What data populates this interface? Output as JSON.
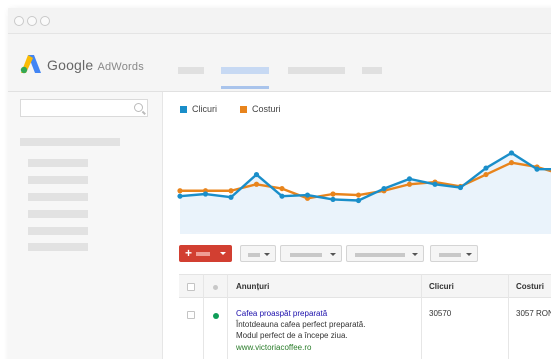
{
  "brand": {
    "name": "Google",
    "product": "AdWords"
  },
  "legend": [
    {
      "label": "Clicuri",
      "color": "#1a8ec9"
    },
    {
      "label": "Costuri",
      "color": "#e8841c"
    }
  ],
  "chart_data": {
    "type": "line",
    "title": "",
    "xlabel": "",
    "ylabel": "",
    "series": [
      {
        "name": "Clicuri",
        "color": "#1a8ec9",
        "values": [
          35,
          37,
          34,
          55,
          35,
          36,
          32,
          31,
          42,
          51,
          46,
          43,
          61,
          75,
          60,
          60
        ]
      },
      {
        "name": "Costuri",
        "color": "#e8841c",
        "values": [
          40,
          40,
          40,
          46,
          42,
          33,
          37,
          36,
          40,
          46,
          48,
          44,
          55,
          66,
          62,
          55
        ]
      }
    ],
    "ylim": [
      0,
      100
    ],
    "grid": false,
    "legend": "top-left"
  },
  "table": {
    "columns": [
      "Anunțuri",
      "Clicuri",
      "Costuri"
    ],
    "row": {
      "title": "Cafea proaspăt preparată",
      "line1": "Întotdeauna cafea perfect preparată.",
      "line2": "Modul perfect de a începe ziua.",
      "url": "www.victoriacoffee.ro",
      "clicks": "30570",
      "cost": "3057 RON"
    }
  }
}
